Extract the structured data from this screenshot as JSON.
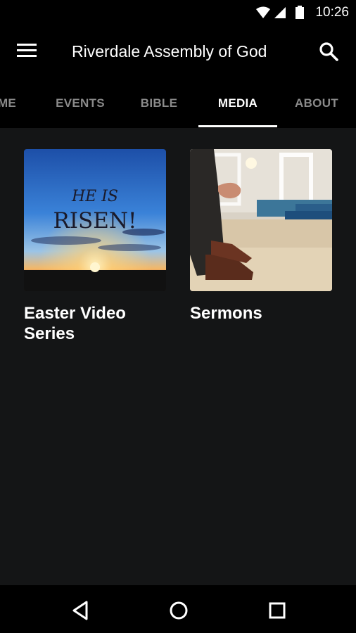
{
  "status_bar": {
    "time": "10:26",
    "icons": [
      "wifi-icon",
      "signal-icon",
      "battery-icon"
    ]
  },
  "app_bar": {
    "title": "Riverdale Assembly of God",
    "menu_icon": "menu-icon",
    "search_icon": "search-icon"
  },
  "tabs": [
    {
      "label": "ME"
    },
    {
      "label": "EVENTS"
    },
    {
      "label": "BIBLE"
    },
    {
      "label": "MEDIA",
      "active": true
    },
    {
      "label": "ABOUT"
    }
  ],
  "cards": [
    {
      "title": "Easter Video Series",
      "image_text_line1": "HE IS",
      "image_text_line2": "RISEN!"
    },
    {
      "title": "Sermons"
    }
  ],
  "nav_bar": {
    "icons": [
      "back-icon",
      "home-icon",
      "recents-icon"
    ]
  },
  "colors": {
    "background": "#141516",
    "bar": "#000000",
    "active_tab": "#ffffff",
    "inactive_tab": "#8a8a8a"
  }
}
